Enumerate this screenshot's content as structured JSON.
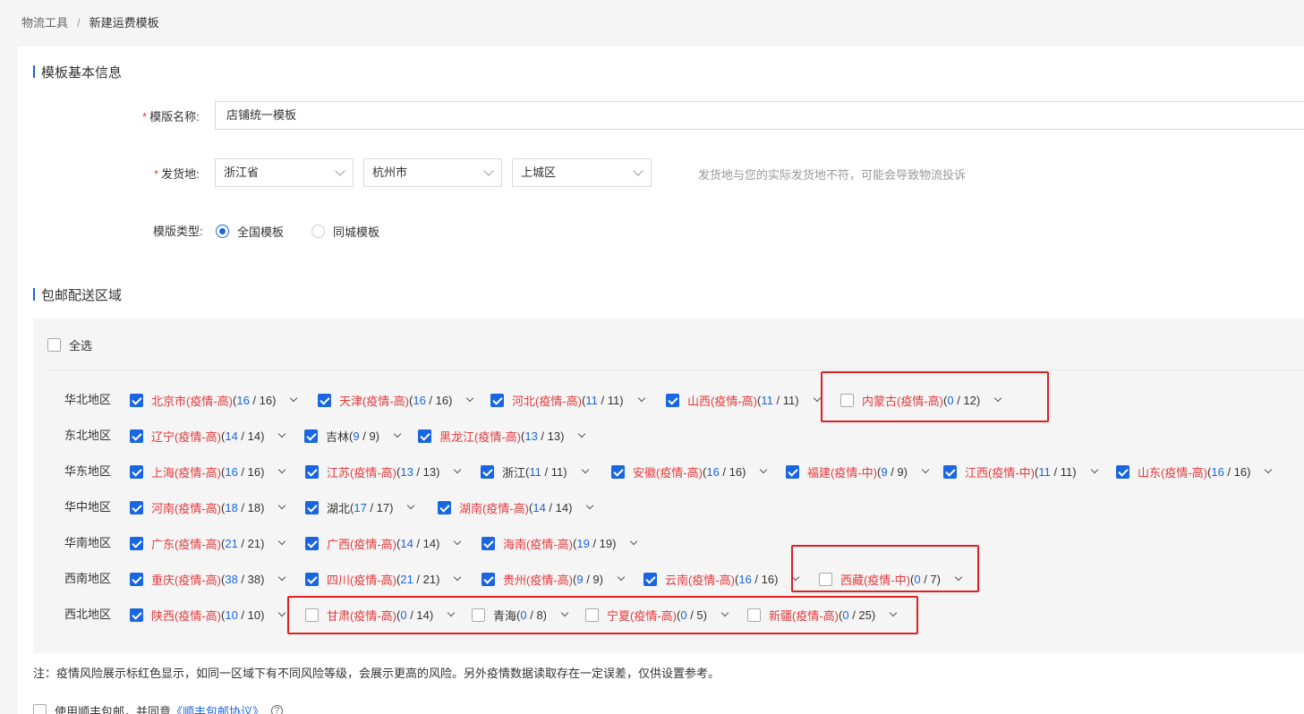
{
  "breadcrumb": {
    "parent": "物流工具",
    "separator": "/",
    "current": "新建运费模板"
  },
  "basic": {
    "section_title": "模板基本信息",
    "name_required": "*",
    "name_label": "模版名称:",
    "name_value": "店铺统一模板",
    "origin_required": "*",
    "origin_label": "发货地:",
    "province": "浙江省",
    "city": "杭州市",
    "district": "上城区",
    "origin_hint": "发货地与您的实际发货地不符，可能会导致物流投诉",
    "type_label": "模版类型:",
    "type_options": [
      "全国模板",
      "同城模板"
    ],
    "type_selected": "全国模板"
  },
  "region": {
    "section_title": "包邮配送区域",
    "select_all_label": "全选",
    "select_all_checked": false,
    "groups": [
      {
        "label": "华北地区",
        "provinces": [
          {
            "name": "北京市(疫情-高)",
            "sel": "16",
            "total": "16",
            "checked": true,
            "risk": true
          },
          {
            "name": "天津(疫情-高)",
            "sel": "16",
            "total": "16",
            "checked": true,
            "risk": true
          },
          {
            "name": "河北(疫情-高)",
            "sel": "11",
            "total": "11",
            "checked": true,
            "risk": true
          },
          {
            "name": "山西(疫情-高)",
            "sel": "11",
            "total": "11",
            "checked": true,
            "risk": true
          },
          {
            "name": "内蒙古(疫情-高)",
            "sel": "0",
            "total": "12",
            "checked": false,
            "risk": true
          }
        ]
      },
      {
        "label": "东北地区",
        "provinces": [
          {
            "name": "辽宁(疫情-高)",
            "sel": "14",
            "total": "14",
            "checked": true,
            "risk": true
          },
          {
            "name": "吉林",
            "sel": "9",
            "total": "9",
            "checked": true,
            "risk": false
          },
          {
            "name": "黑龙江(疫情-高)",
            "sel": "13",
            "total": "13",
            "checked": true,
            "risk": true
          }
        ]
      },
      {
        "label": "华东地区",
        "provinces": [
          {
            "name": "上海(疫情-高)",
            "sel": "16",
            "total": "16",
            "checked": true,
            "risk": true
          },
          {
            "name": "江苏(疫情-高)",
            "sel": "13",
            "total": "13",
            "checked": true,
            "risk": true
          },
          {
            "name": "浙江",
            "sel": "11",
            "total": "11",
            "checked": true,
            "risk": false
          },
          {
            "name": "安徽(疫情-高)",
            "sel": "16",
            "total": "16",
            "checked": true,
            "risk": true
          },
          {
            "name": "福建(疫情-中)",
            "sel": "9",
            "total": "9",
            "checked": true,
            "risk": true
          },
          {
            "name": "江西(疫情-中)",
            "sel": "11",
            "total": "11",
            "checked": true,
            "risk": true
          },
          {
            "name": "山东(疫情-高)",
            "sel": "16",
            "total": "16",
            "checked": true,
            "risk": true
          }
        ]
      },
      {
        "label": "华中地区",
        "provinces": [
          {
            "name": "河南(疫情-高)",
            "sel": "18",
            "total": "18",
            "checked": true,
            "risk": true
          },
          {
            "name": "湖北",
            "sel": "17",
            "total": "17",
            "checked": true,
            "risk": false
          },
          {
            "name": "湖南(疫情-高)",
            "sel": "14",
            "total": "14",
            "checked": true,
            "risk": true
          }
        ]
      },
      {
        "label": "华南地区",
        "provinces": [
          {
            "name": "广东(疫情-高)",
            "sel": "21",
            "total": "21",
            "checked": true,
            "risk": true
          },
          {
            "name": "广西(疫情-高)",
            "sel": "14",
            "total": "14",
            "checked": true,
            "risk": true
          },
          {
            "name": "海南(疫情-高)",
            "sel": "19",
            "total": "19",
            "checked": true,
            "risk": true
          }
        ]
      },
      {
        "label": "西南地区",
        "provinces": [
          {
            "name": "重庆(疫情-高)",
            "sel": "38",
            "total": "38",
            "checked": true,
            "risk": true
          },
          {
            "name": "四川(疫情-高)",
            "sel": "21",
            "total": "21",
            "checked": true,
            "risk": true
          },
          {
            "name": "贵州(疫情-高)",
            "sel": "9",
            "total": "9",
            "checked": true,
            "risk": true
          },
          {
            "name": "云南(疫情-高)",
            "sel": "16",
            "total": "16",
            "checked": true,
            "risk": true
          },
          {
            "name": "西藏(疫情-中)",
            "sel": "0",
            "total": "7",
            "checked": false,
            "risk": true
          }
        ]
      },
      {
        "label": "西北地区",
        "provinces": [
          {
            "name": "陕西(疫情-高)",
            "sel": "10",
            "total": "10",
            "checked": true,
            "risk": true
          },
          {
            "name": "甘肃(疫情-高)",
            "sel": "0",
            "total": "14",
            "checked": false,
            "risk": true
          },
          {
            "name": "青海",
            "sel": "0",
            "total": "8",
            "checked": false,
            "risk": false
          },
          {
            "name": "宁夏(疫情-高)",
            "sel": "0",
            "total": "5",
            "checked": false,
            "risk": true
          },
          {
            "name": "新疆(疫情-高)",
            "sel": "0",
            "total": "25",
            "checked": false,
            "risk": true
          }
        ]
      }
    ]
  },
  "note": "注：疫情风险展示标红色显示，如同一区域下有不同风险等级，会展示更高的风险。另外疫情数据读取存在一定误差，仅供设置参考。",
  "agreement": {
    "checked": false,
    "text": "使用顺丰包邮，并同意",
    "link": "《顺丰包邮协议》",
    "help_icon": "?"
  },
  "colors": {
    "accent": "#1a66e0",
    "risk": "#e4393c",
    "highlight_box": "#e02020"
  }
}
